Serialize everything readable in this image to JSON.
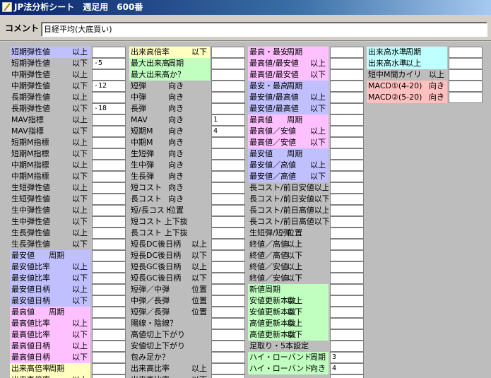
{
  "window": {
    "title": "JP法分析シート　週足用　600番"
  },
  "comment": {
    "label": "コメント",
    "value": "日経平均(大底買い)"
  },
  "columns": [
    {
      "items": [
        {
          "label": "短期弾性値",
          "suffix": "以上",
          "value": "",
          "color": "blue"
        },
        {
          "label": "短期弾性値",
          "suffix": "以下",
          "value": "-5",
          "color": "gray"
        },
        {
          "label": "中期弾性値",
          "suffix": "以上",
          "value": "",
          "color": "gray"
        },
        {
          "label": "中期弾性値",
          "suffix": "以下",
          "value": "-12",
          "color": "gray"
        },
        {
          "label": "長期弾性値",
          "suffix": "以上",
          "value": "",
          "color": "gray"
        },
        {
          "label": "長期弾性値",
          "suffix": "以下",
          "value": "-18",
          "color": "gray"
        },
        {
          "label": "MAV指標",
          "suffix": "以上",
          "value": "",
          "color": "gray"
        },
        {
          "label": "MAV指標",
          "suffix": "以下",
          "value": "",
          "color": "gray"
        },
        {
          "label": "短期M指標",
          "suffix": "以上",
          "value": "",
          "color": "gray"
        },
        {
          "label": "短期M指標",
          "suffix": "以下",
          "value": "",
          "color": "gray"
        },
        {
          "label": "中期M指標",
          "suffix": "以上",
          "value": "",
          "color": "gray"
        },
        {
          "label": "中期M指標",
          "suffix": "以下",
          "value": "",
          "color": "gray"
        },
        {
          "label": "生短弾性値",
          "suffix": "以上",
          "value": "",
          "color": "gray"
        },
        {
          "label": "生短弾性値",
          "suffix": "以下",
          "value": "",
          "color": "gray"
        },
        {
          "label": "生中弾性値",
          "suffix": "以上",
          "value": "",
          "color": "gray"
        },
        {
          "label": "生中弾性値",
          "suffix": "以下",
          "value": "",
          "color": "gray"
        },
        {
          "label": "生長弾性値",
          "suffix": "以上",
          "value": "",
          "color": "gray"
        },
        {
          "label": "生長弾性値",
          "suffix": "以下",
          "value": "",
          "color": "gray"
        },
        {
          "label": "最安値",
          "suffix": "周期",
          "value": "",
          "color": "blue",
          "mid": true
        },
        {
          "label": "最安値比率",
          "suffix": "以上",
          "value": "",
          "color": "blue"
        },
        {
          "label": "最安値比率",
          "suffix": "以下",
          "value": "",
          "color": "blue"
        },
        {
          "label": "最安値日柄",
          "suffix": "以上",
          "value": "",
          "color": "blue"
        },
        {
          "label": "最安値日柄",
          "suffix": "以下",
          "value": "",
          "color": "blue"
        },
        {
          "label": "最高値",
          "suffix": "周期",
          "value": "",
          "color": "pink",
          "mid": true
        },
        {
          "label": "最高値比率",
          "suffix": "以上",
          "value": "",
          "color": "pink"
        },
        {
          "label": "最高値比率",
          "suffix": "以下",
          "value": "",
          "color": "pink"
        },
        {
          "label": "最高値日柄",
          "suffix": "以上",
          "value": "",
          "color": "pink"
        },
        {
          "label": "最高値日柄",
          "suffix": "以下",
          "value": "",
          "color": "pink"
        },
        {
          "label": "出来高倍率",
          "suffix": "周期",
          "value": "",
          "color": "yellow",
          "mid": true
        },
        {
          "label": "出来高倍率",
          "suffix": "以上",
          "value": "",
          "color": "yellow"
        }
      ]
    },
    {
      "items": [
        {
          "label": "出来高倍率",
          "suffix": "以下",
          "value": "",
          "color": "yellow"
        },
        {
          "label": "最大出来高",
          "suffix": "周期",
          "value": "",
          "color": "green",
          "mid": true
        },
        {
          "label": "最大出来高か？",
          "suffix": "",
          "value": "",
          "color": "green"
        },
        {
          "label": "短弾",
          "suffix": "向き",
          "value": "",
          "color": "gray",
          "mid": true
        },
        {
          "label": "中弾",
          "suffix": "向き",
          "value": "",
          "color": "gray",
          "mid": true
        },
        {
          "label": "長弾",
          "suffix": "向き",
          "value": "",
          "color": "gray",
          "mid": true
        },
        {
          "label": "MAV",
          "suffix": "向き",
          "value": "1",
          "color": "gray",
          "mid": true
        },
        {
          "label": "短期M",
          "suffix": "向き",
          "value": "4",
          "color": "gray",
          "mid": true
        },
        {
          "label": "中期M",
          "suffix": "向き",
          "value": "",
          "color": "gray",
          "mid": true
        },
        {
          "label": "生短弾",
          "suffix": "向き",
          "value": "",
          "color": "gray",
          "mid": true
        },
        {
          "label": "生中弾",
          "suffix": "向き",
          "value": "",
          "color": "gray",
          "mid": true
        },
        {
          "label": "生長弾",
          "suffix": "向き",
          "value": "",
          "color": "gray",
          "mid": true
        },
        {
          "label": "短コスト",
          "suffix": "向き",
          "value": "",
          "color": "gray",
          "mid": true
        },
        {
          "label": "長コスト",
          "suffix": "向き",
          "value": "",
          "color": "gray",
          "mid": true
        },
        {
          "label": "短/長コスト",
          "suffix": "位置",
          "value": "",
          "color": "gray",
          "mid": true
        },
        {
          "label": "短コスト",
          "suffix": "上下抜",
          "value": "",
          "color": "gray",
          "mid": true
        },
        {
          "label": "長コスト",
          "suffix": "上下抜",
          "value": "",
          "color": "gray",
          "mid": true
        },
        {
          "label": "短長DC後日柄",
          "suffix": "以上",
          "value": "",
          "color": "gray"
        },
        {
          "label": "短長DC後日柄",
          "suffix": "以下",
          "value": "",
          "color": "gray"
        },
        {
          "label": "短長GC後日柄",
          "suffix": "以上",
          "value": "",
          "color": "gray"
        },
        {
          "label": "短長GC後日柄",
          "suffix": "以下",
          "value": "",
          "color": "gray"
        },
        {
          "label": "短弾／中弾",
          "suffix": "位置",
          "value": "",
          "color": "gray"
        },
        {
          "label": "中弾／長弾",
          "suffix": "位置",
          "value": "",
          "color": "gray"
        },
        {
          "label": "短弾／長弾",
          "suffix": "位置",
          "value": "",
          "color": "gray"
        },
        {
          "label": "陽線・陰線？",
          "suffix": "",
          "value": "",
          "color": "gray"
        },
        {
          "label": "高値切上下がり",
          "suffix": "",
          "value": "",
          "color": "gray"
        },
        {
          "label": "安値切上下がり",
          "suffix": "",
          "value": "",
          "color": "gray"
        },
        {
          "label": "包み足か？",
          "suffix": "",
          "value": "",
          "color": "gray"
        },
        {
          "label": "出来高比率",
          "suffix": "以上",
          "value": "",
          "color": "gray"
        },
        {
          "label": "出来高比率",
          "suffix": "以下",
          "value": "",
          "color": "gray"
        }
      ]
    },
    {
      "items": [
        {
          "label": "最高・最安",
          "suffix": "周期",
          "value": "",
          "color": "pink",
          "mid": true
        },
        {
          "label": "最高値/最安値",
          "suffix": "以上",
          "value": "",
          "color": "pink"
        },
        {
          "label": "最高値/最安値",
          "suffix": "以下",
          "value": "",
          "color": "pink"
        },
        {
          "label": "最安・最高",
          "suffix": "周期",
          "value": "",
          "color": "blue",
          "mid": true
        },
        {
          "label": "最安値/最高値",
          "suffix": "以上",
          "value": "",
          "color": "blue"
        },
        {
          "label": "最安値/最高値",
          "suffix": "以下",
          "value": "",
          "color": "blue"
        },
        {
          "label": "最高値",
          "suffix": "周期",
          "value": "",
          "color": "pink",
          "mid": true
        },
        {
          "label": "最高値／安値",
          "suffix": "以上",
          "value": "",
          "color": "pink"
        },
        {
          "label": "最高値／安値",
          "suffix": "以下",
          "value": "",
          "color": "pink"
        },
        {
          "label": "最安値",
          "suffix": "周期",
          "value": "",
          "color": "blue",
          "mid": true
        },
        {
          "label": "最安値／高値",
          "suffix": "以上",
          "value": "",
          "color": "blue"
        },
        {
          "label": "最安値／高値",
          "suffix": "以下",
          "value": "",
          "color": "blue"
        },
        {
          "label": "長コスト/前日安値以上",
          "suffix": "",
          "value": "",
          "color": "gray"
        },
        {
          "label": "長コスト/前日安値以下",
          "suffix": "",
          "value": "",
          "color": "gray"
        },
        {
          "label": "長コスト/前日高値以上",
          "suffix": "",
          "value": "",
          "color": "gray"
        },
        {
          "label": "長コスト/前日高値以下",
          "suffix": "",
          "value": "",
          "color": "gray"
        },
        {
          "label": "生短弾/短弾",
          "suffix": "位置",
          "value": "",
          "color": "gray",
          "mid": true
        },
        {
          "label": "終値／高値",
          "suffix": "以上",
          "value": "",
          "color": "gray",
          "mid": true
        },
        {
          "label": "終値／高値",
          "suffix": "以下",
          "value": "",
          "color": "gray",
          "mid": true
        },
        {
          "label": "終値／安値",
          "suffix": "以上",
          "value": "",
          "color": "gray",
          "mid": true
        },
        {
          "label": "終値／安値",
          "suffix": "以下",
          "value": "",
          "color": "gray",
          "mid": true
        },
        {
          "label": "新値周期",
          "suffix": "",
          "value": "",
          "color": "green"
        },
        {
          "label": "安値更新本数",
          "suffix": "以上",
          "value": "",
          "color": "green",
          "mid": true
        },
        {
          "label": "安値更新本数",
          "suffix": "以下",
          "value": "",
          "color": "green",
          "mid": true
        },
        {
          "label": "高値更新本数",
          "suffix": "以上",
          "value": "",
          "color": "green",
          "mid": true
        },
        {
          "label": "高値更新本数",
          "suffix": "以下",
          "value": "",
          "color": "green",
          "mid": true
        },
        {
          "label": "足取り・5本設定",
          "suffix": "",
          "value": "",
          "color": "gray"
        },
        {
          "label": "ハイ・ローバンド",
          "suffix": "周期",
          "value": "3",
          "color": "green"
        },
        {
          "label": "ハイ・ローバンド",
          "suffix": "向き",
          "value": "4",
          "color": "green"
        },
        {
          "label": "",
          "suffix": "",
          "value": "",
          "color": "gray"
        }
      ]
    },
    {
      "items": [
        {
          "label": "出来高水準",
          "suffix": "周期",
          "value": "",
          "color": "cyan",
          "mid": true
        },
        {
          "label": "出来高水準",
          "suffix": "以上",
          "value": "",
          "color": "cyan",
          "mid": true
        },
        {
          "label": "短中M間カイリ",
          "suffix": "以上",
          "value": "",
          "color": "gray"
        },
        {
          "label": "MACD①(4-20)",
          "suffix": "向き",
          "value": "",
          "color": "salmon"
        },
        {
          "label": "MACD②(5-20)",
          "suffix": "向き",
          "value": "",
          "color": "salmon"
        }
      ]
    }
  ]
}
